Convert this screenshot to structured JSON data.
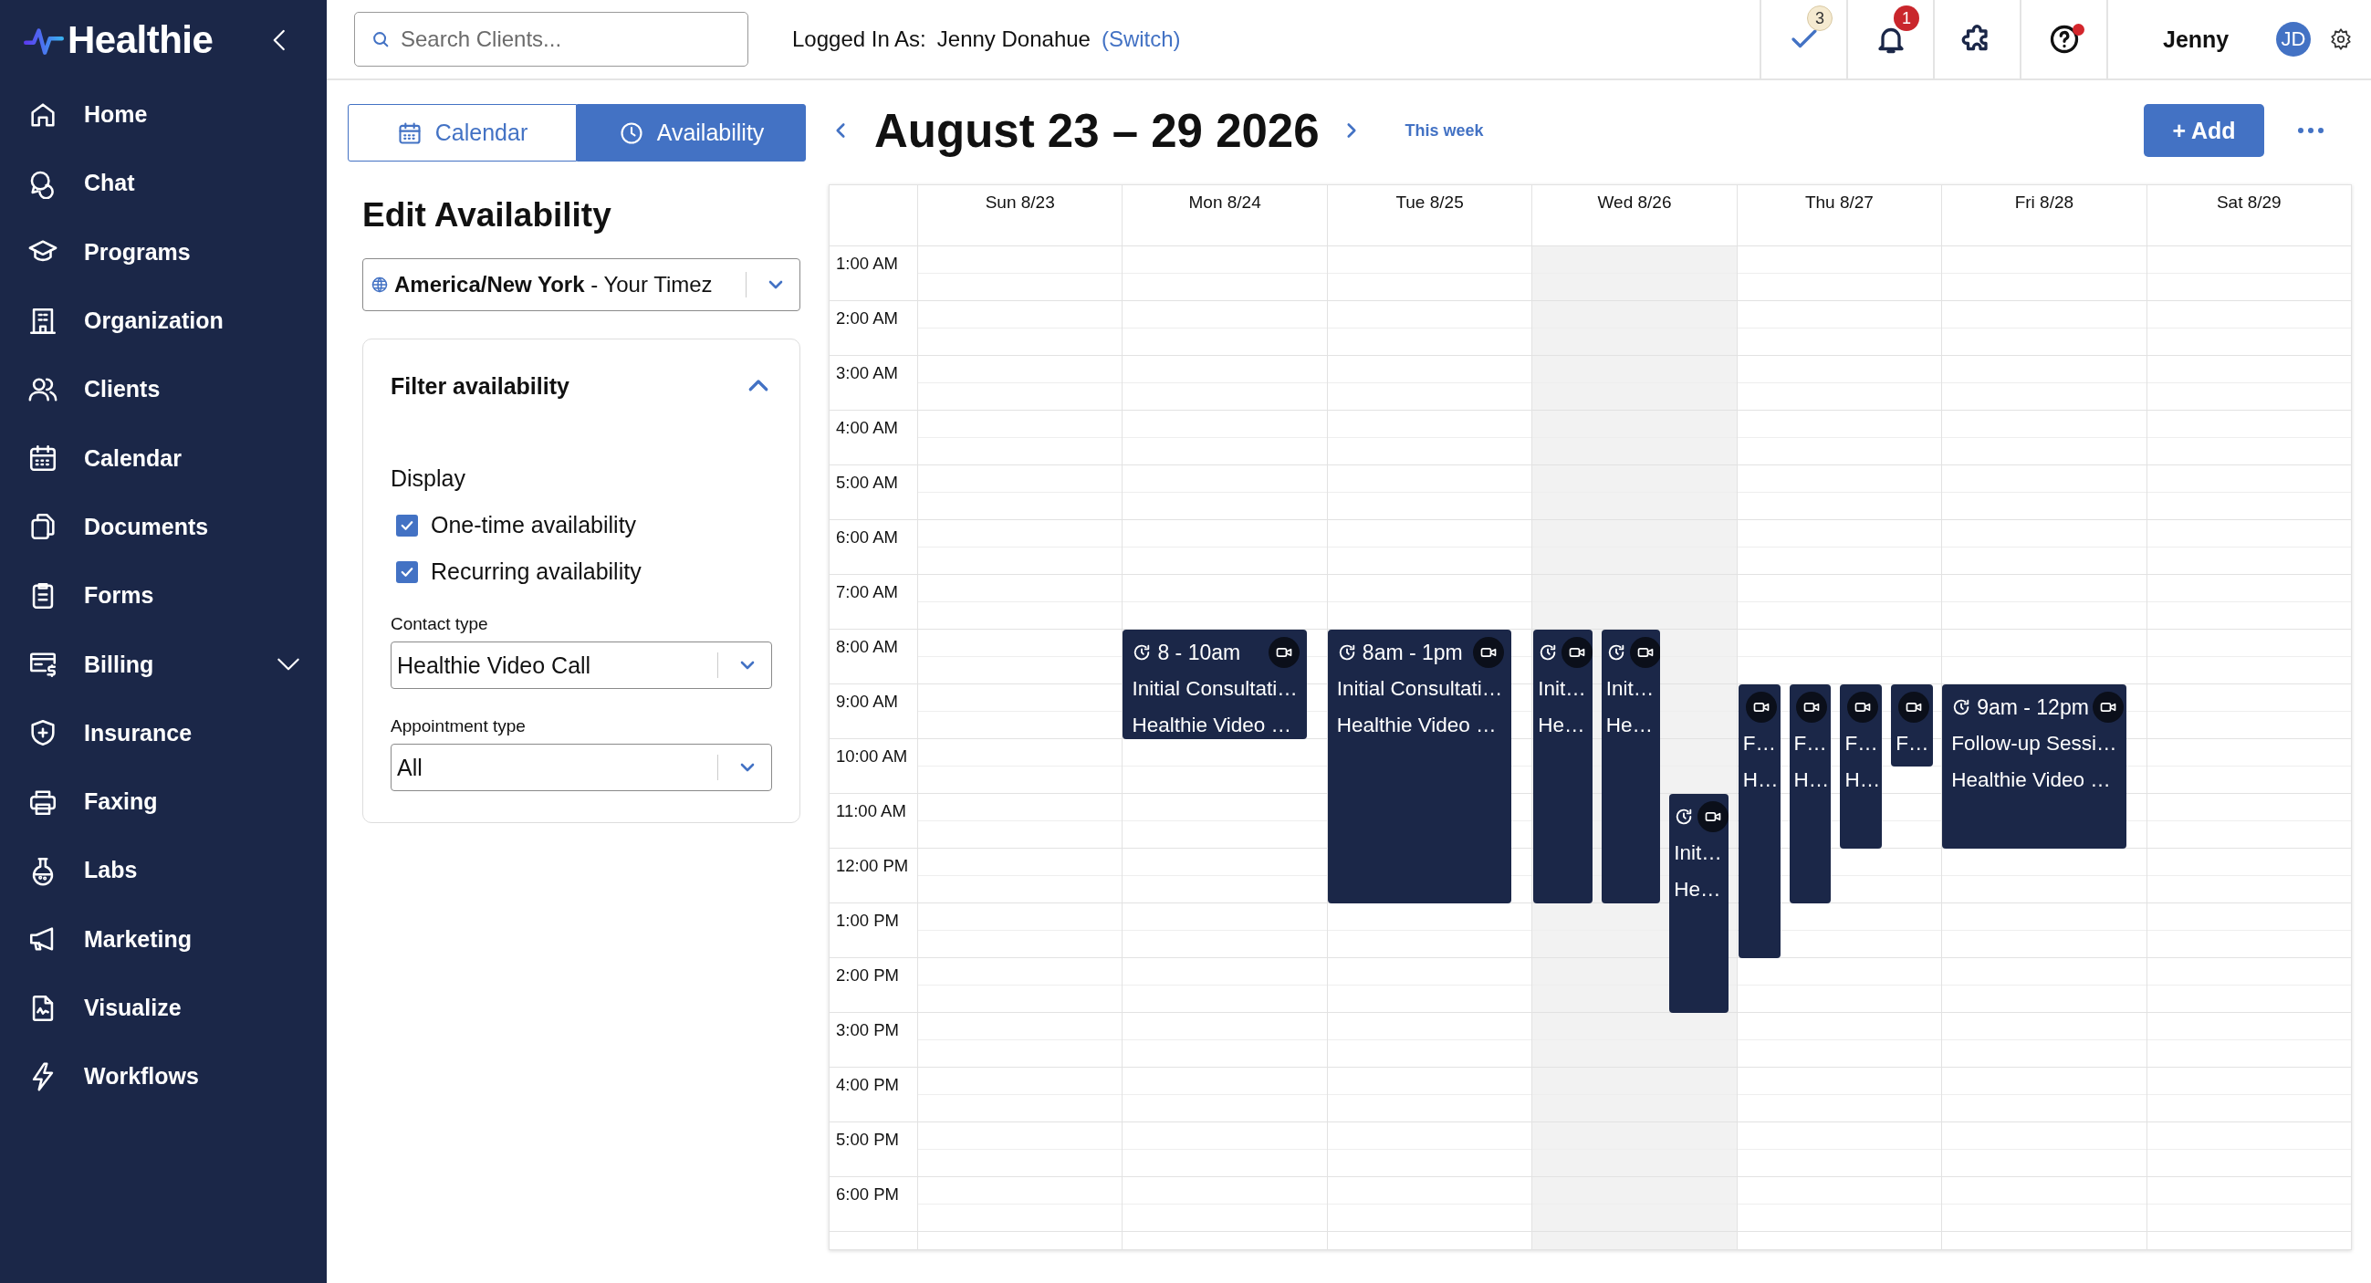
{
  "sidebar": {
    "logo": "Healthie",
    "items": [
      {
        "label": "Home",
        "kind": "link"
      },
      {
        "label": "Chat",
        "kind": "link"
      },
      {
        "label": "Programs",
        "kind": "link"
      },
      {
        "label": "Organization",
        "kind": "link"
      },
      {
        "label": "Clients",
        "kind": "link"
      },
      {
        "label": "Calendar",
        "kind": "link"
      },
      {
        "label": "Documents",
        "kind": "link"
      },
      {
        "label": "Forms",
        "kind": "link"
      },
      {
        "label": "Billing",
        "kind": "group",
        "expanded": false
      },
      {
        "label": "Insurance",
        "kind": "link"
      },
      {
        "label": "Faxing",
        "kind": "link"
      },
      {
        "label": "Labs",
        "kind": "link"
      },
      {
        "label": "Marketing",
        "kind": "link"
      },
      {
        "label": "Visualize",
        "kind": "link"
      },
      {
        "label": "Workflows",
        "kind": "link"
      }
    ]
  },
  "topbar": {
    "search": {
      "placeholder": "Search Clients..."
    },
    "logged_in_label": "Logged In As:",
    "user_full_name": "Jenny Donahue",
    "switch_link": "(Switch)",
    "icons": [
      {
        "kind": "tasks",
        "badge": "3"
      },
      {
        "kind": "notifications",
        "badge": "1"
      },
      {
        "kind": "integrations"
      },
      {
        "kind": "help",
        "alert": true
      }
    ],
    "user_name": "Jenny",
    "avatar": "JD"
  },
  "view_tabs": [
    {
      "label": "Calendar",
      "selected": false
    },
    {
      "label": "Availability",
      "selected": true
    }
  ],
  "panel": {
    "title": "Edit Availability",
    "timezone": "**America/New York** - Your Timez",
    "filter": {
      "title": "Filter availability",
      "expanded": true,
      "display_label": "Display",
      "checkboxes": [
        {
          "label": "One-time availability",
          "checked": true
        },
        {
          "label": "Recurring availability",
          "checked": true
        }
      ],
      "selects": [
        {
          "label": "Contact type",
          "value": "Healthie Video Call"
        },
        {
          "label": "Appointment type",
          "value": "All"
        }
      ]
    }
  },
  "calendar": {
    "title": "August 23 – 29 2026",
    "this_week": "This week",
    "add_button": "+ Add",
    "hours": [
      "1:00 AM",
      "2:00 AM",
      "3:00 AM",
      "4:00 AM",
      "5:00 AM",
      "6:00 AM",
      "7:00 AM",
      "8:00 AM",
      "9:00 AM",
      "10:00 AM",
      "11:00 AM",
      "12:00 PM",
      "1:00 PM",
      "2:00 PM",
      "3:00 PM",
      "4:00 PM",
      "5:00 PM",
      "6:00 PM"
    ],
    "days": [
      {
        "label": "Sun 8/23",
        "today": false
      },
      {
        "label": "Mon 8/24",
        "today": false,
        "events": [
          {
            "recurring": true,
            "time": "8 - 10am",
            "title": "Initial Consultati…",
            "location": "Healthie Video …"
          }
        ]
      },
      {
        "label": "Tue 8/25",
        "today": false,
        "events": [
          {
            "recurring": true,
            "time": "8am - 1pm",
            "title": "Initial Consultati…",
            "location": "Healthie Video …"
          }
        ]
      },
      {
        "label": "Wed 8/26",
        "today": true,
        "events": [
          {
            "recurring": true,
            "title": "Init…",
            "location": "He…"
          },
          {
            "recurring": true,
            "title": "Init…",
            "location": "He…"
          },
          {
            "recurring": true,
            "title": "Init…",
            "location": "He…"
          }
        ]
      },
      {
        "label": "Thu 8/27",
        "today": false,
        "events": [
          {
            "recurring": false,
            "title": "F…",
            "location": "H…"
          },
          {
            "recurring": false,
            "title": "F…",
            "location": "H…"
          },
          {
            "recurring": false,
            "title": "F…",
            "location": "H…"
          },
          {
            "recurring": false,
            "title": "F…"
          }
        ]
      },
      {
        "label": "Fri 8/28",
        "today": false,
        "events": [
          {
            "recurring": true,
            "time": "9am - 12pm",
            "title": "Follow-up Sessi…",
            "location": "Healthie Video …"
          }
        ]
      },
      {
        "label": "Sat 8/29",
        "today": false
      }
    ]
  }
}
